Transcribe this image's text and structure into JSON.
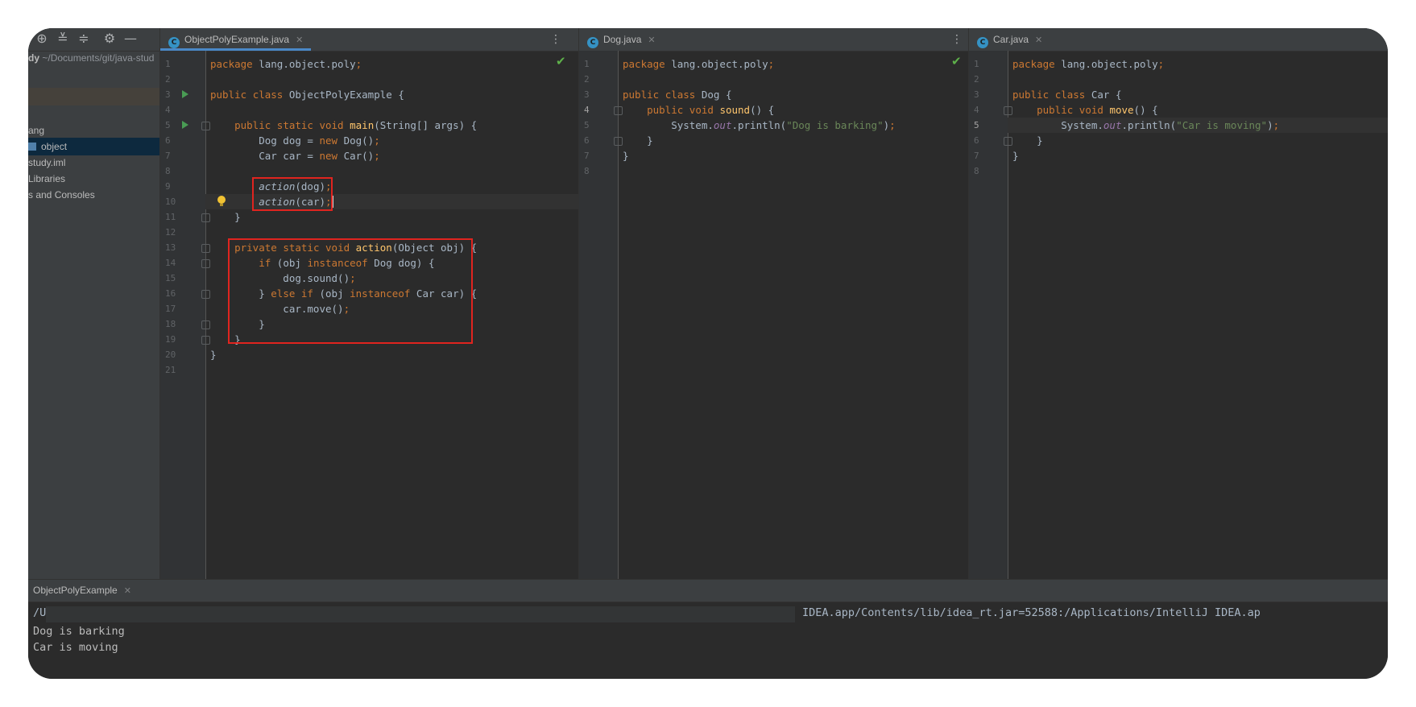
{
  "project": {
    "path_name": "dy",
    "path_rest": " ~/Documents/git/java-stud",
    "items": [
      "ang",
      "object",
      "study.iml",
      "Libraries",
      "s and Consoles"
    ]
  },
  "editors": [
    {
      "tab": "ObjectPolyExample.java",
      "lines": [
        "package lang.object.poly;",
        "",
        "public class ObjectPolyExample {",
        "",
        "    public static void main(String[] args) {",
        "        Dog dog = new Dog();",
        "        Car car = new Car();",
        "",
        "        action(dog);",
        "        action(car);",
        "    }",
        "",
        "    private static void action(Object obj) {",
        "        if (obj instanceof Dog dog) {",
        "            dog.sound();",
        "        } else if (obj instanceof Car car) {",
        "            car.move();",
        "        }",
        "    }",
        "}",
        ""
      ]
    },
    {
      "tab": "Dog.java",
      "lines": [
        "package lang.object.poly;",
        "",
        "public class Dog {",
        "    public void sound() {",
        "        System.out.println(\"Dog is barking\");",
        "    }",
        "}",
        ""
      ]
    },
    {
      "tab": "Car.java",
      "lines": [
        "package lang.object.poly;",
        "",
        "public class Car {",
        "    public void move() {",
        "        System.out.println(\"Car is moving\");",
        "    }",
        "}",
        ""
      ]
    }
  ],
  "run": {
    "tab": "ObjectPolyExample",
    "cmd_start": "/U",
    "cmd_tail": "IDEA.app/Contents/lib/idea_rt.jar=52588:/Applications/IntelliJ IDEA.ap",
    "output": [
      "Dog is barking",
      "Car is moving"
    ]
  },
  "icons": {
    "toolbar": [
      "target-icon",
      "expand-all-icon",
      "collapse-all-icon",
      "gear-icon",
      "minimize-icon"
    ],
    "colors": {
      "keyword": "#cc7832",
      "function": "#ffc66d",
      "string": "#6a8759",
      "highlight": "#e0241f"
    }
  }
}
